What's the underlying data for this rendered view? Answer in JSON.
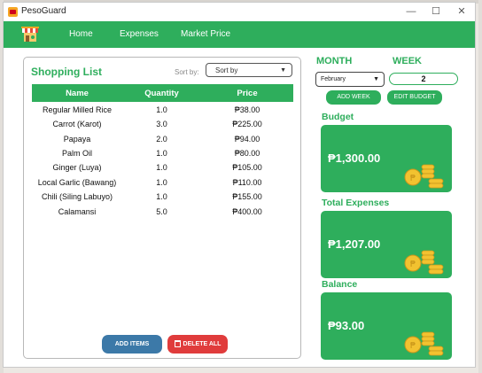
{
  "window": {
    "title": "PesoGuard",
    "controls": {
      "minimize": "—",
      "maximize": "☐",
      "close": "✕"
    }
  },
  "nav": {
    "items": [
      {
        "label": "Home",
        "active": true
      },
      {
        "label": "Expenses",
        "active": false
      },
      {
        "label": "Market Price",
        "active": false
      }
    ]
  },
  "shopping_list": {
    "title": "Shopping List",
    "sort_label": "Sort by:",
    "sort_value": "Sort by",
    "columns": [
      "Name",
      "Quantity",
      "Price"
    ],
    "rows": [
      {
        "name": "Regular Milled Rice",
        "quantity": "1.0",
        "price": "₱38.00"
      },
      {
        "name": "Carrot (Karot)",
        "quantity": "3.0",
        "price": "₱225.00"
      },
      {
        "name": "Papaya",
        "quantity": "2.0",
        "price": "₱94.00"
      },
      {
        "name": "Palm Oil",
        "quantity": "1.0",
        "price": "₱80.00"
      },
      {
        "name": "Ginger (Luya)",
        "quantity": "1.0",
        "price": "₱105.00"
      },
      {
        "name": "Local Garlic (Bawang)",
        "quantity": "1.0",
        "price": "₱110.00"
      },
      {
        "name": "Chili (Siling Labuyo)",
        "quantity": "1.0",
        "price": "₱155.00"
      },
      {
        "name": "Calamansi",
        "quantity": "5.0",
        "price": "₱400.00"
      }
    ],
    "add_label": "ADD ITEMS",
    "delete_label": "DELETE ALL"
  },
  "period": {
    "month_label": "MONTH",
    "week_label": "WEEK",
    "month_value": "February",
    "week_value": "2",
    "add_week_label": "ADD WEEK",
    "edit_budget_label": "EDIT BUDGET"
  },
  "stats": {
    "budget_label": "Budget",
    "budget_value": "₱1,300.00",
    "expenses_label": "Total Expenses",
    "expenses_value": "₱1,207.00",
    "balance_label": "Balance",
    "balance_value": "₱93.00"
  },
  "colors": {
    "accent": "#2eae5c",
    "add_button": "#3c79a8",
    "delete_button": "#e03c3c",
    "coin": "#f2c230"
  },
  "icons": {
    "logo": "market-stall-icon",
    "trash": "trash-icon",
    "coins": "coin-stack-icon",
    "dropdown": "chevron-down-icon"
  }
}
